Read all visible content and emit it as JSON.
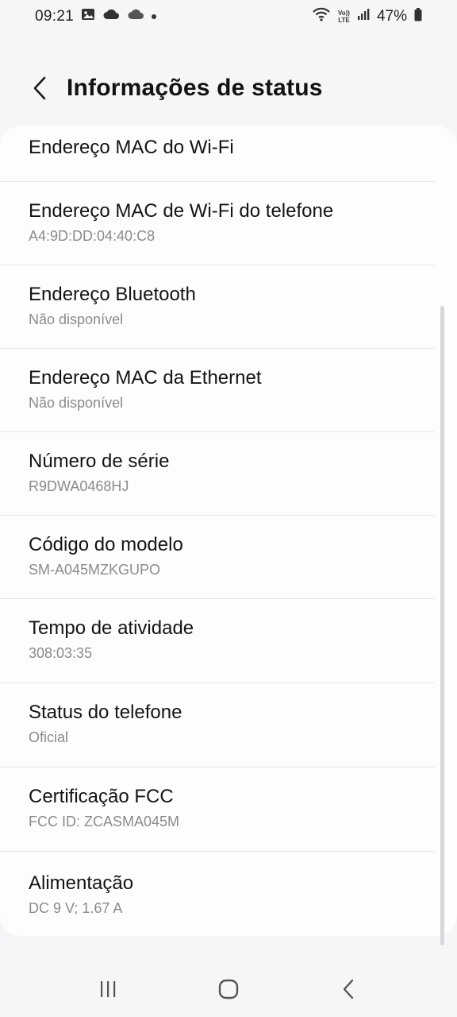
{
  "status_bar": {
    "time": "09:21",
    "network_label_top": "Vo))",
    "network_label_bottom": "LTE",
    "battery_percent": "47%"
  },
  "header": {
    "title": "Informações de status"
  },
  "items": [
    {
      "title": "Endereço MAC do Wi-Fi",
      "value": ""
    },
    {
      "title": "Endereço MAC de Wi-Fi do telefone",
      "value": "A4:9D:DD:04:40:C8"
    },
    {
      "title": "Endereço Bluetooth",
      "value": "Não disponível"
    },
    {
      "title": "Endereço MAC da Ethernet",
      "value": "Não disponível"
    },
    {
      "title": "Número de série",
      "value": "R9DWA0468HJ"
    },
    {
      "title": "Código do modelo",
      "value": "SM-A045MZKGUPO"
    },
    {
      "title": "Tempo de atividade",
      "value": "308:03:35"
    },
    {
      "title": "Status do telefone",
      "value": "Oficial"
    },
    {
      "title": "Certificação FCC",
      "value": "FCC ID: ZCASMA045M"
    },
    {
      "title": "Alimentação",
      "value": "DC 9 V; 1.67 A"
    }
  ],
  "colors": {
    "background": "#f6f6f8",
    "card": "#fdfdfe",
    "title_text": "#141416",
    "secondary_text": "#8b8b8f"
  }
}
